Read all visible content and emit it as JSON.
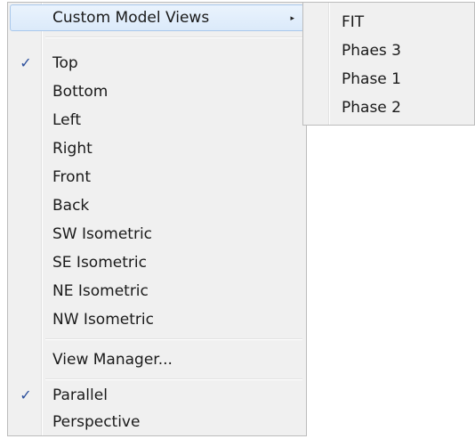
{
  "menu": {
    "items": [
      {
        "label": "Custom Model Views",
        "checked": false,
        "submenu": true,
        "highlighted": true
      },
      {
        "label": "Top",
        "checked": true
      },
      {
        "label": "Bottom",
        "checked": false
      },
      {
        "label": "Left",
        "checked": false
      },
      {
        "label": "Right",
        "checked": false
      },
      {
        "label": "Front",
        "checked": false
      },
      {
        "label": "Back",
        "checked": false
      },
      {
        "label": "SW Isometric",
        "checked": false
      },
      {
        "label": "SE Isometric",
        "checked": false
      },
      {
        "label": "NE Isometric",
        "checked": false
      },
      {
        "label": "NW Isometric",
        "checked": false
      },
      {
        "label": "View Manager...",
        "checked": false
      },
      {
        "label": "Parallel",
        "checked": true
      },
      {
        "label": "Perspective",
        "checked": false
      }
    ],
    "check_glyph": "✓",
    "submenu_arrow": "▸"
  },
  "submenu": {
    "items": [
      {
        "label": "FIT"
      },
      {
        "label": "Phaes 3"
      },
      {
        "label": "Phase 1"
      },
      {
        "label": "Phase 2"
      }
    ]
  },
  "colors": {
    "menu_background": "#f0f0f0",
    "highlight_border": "#a9c8ec",
    "check_mark": "#2b4f9c"
  }
}
